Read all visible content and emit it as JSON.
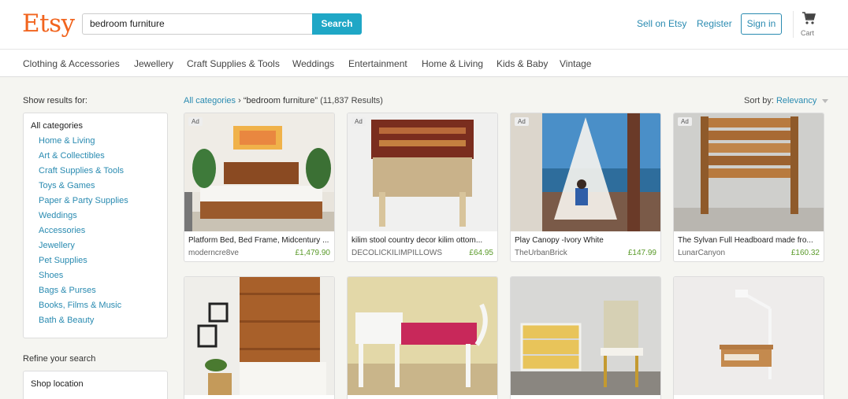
{
  "brand": {
    "logo": "Etsy",
    "color": "#f1641e"
  },
  "search": {
    "value": "bedroom furniture",
    "button": "Search"
  },
  "header": {
    "sell": "Sell on Etsy",
    "register": "Register",
    "signin": "Sign in",
    "cart": "Cart"
  },
  "nav": [
    "Clothing & Accessories",
    "Jewellery",
    "Craft Supplies & Tools",
    "Weddings",
    "Entertainment",
    "Home & Living",
    "Kids & Baby",
    "Vintage"
  ],
  "sidebar": {
    "title": "Show results for:",
    "all": "All categories",
    "categories": [
      "Home & Living",
      "Art & Collectibles",
      "Craft Supplies & Tools",
      "Toys & Games",
      "Paper & Party Supplies",
      "Weddings",
      "Accessories",
      "Jewellery",
      "Pet Supplies",
      "Shoes",
      "Bags & Purses",
      "Books, Films & Music",
      "Bath & Beauty"
    ],
    "refine": "Refine your search",
    "location": "Shop location"
  },
  "results": {
    "crumb_link": "All categories",
    "separator": "›",
    "query": "“bedroom furniture”",
    "count": "(11,837 Results)",
    "sort_label": "Sort by:",
    "sort_value": "Relevancy"
  },
  "listings": [
    {
      "ad": "Ad",
      "title": "Platform Bed, Bed Frame, Midcentury ...",
      "shop": "moderncre8ve",
      "price": "£1,479.90"
    },
    {
      "ad": "Ad",
      "title": "kilim stool country decor kilim ottom...",
      "shop": "DECOLICKILIMPILLOWS",
      "price": "£64.95"
    },
    {
      "ad": "Ad",
      "title": "Play Canopy -Ivory White",
      "shop": "TheUrbanBrick",
      "price": "£147.99"
    },
    {
      "ad": "Ad",
      "title": "The Sylvan Full Headboard made fro...",
      "shop": "LunarCanyon",
      "price": "£160.32"
    }
  ],
  "colors": {
    "link": "#2a8bb1",
    "search_button": "#1fa7c6",
    "price": "#5a9a2a"
  },
  "icons": [
    "cart-icon",
    "caret-down-icon"
  ]
}
